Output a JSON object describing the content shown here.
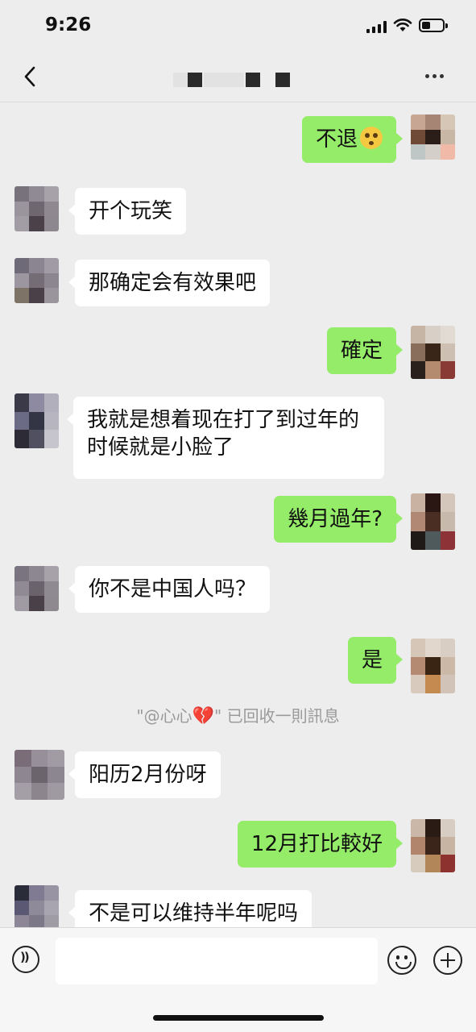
{
  "status": {
    "time": "9:26"
  },
  "header": {
    "back_icon": "chevron-left-icon",
    "more_icon": "more-dots-icon"
  },
  "messages": [
    {
      "side": "out",
      "text": "不退"
    },
    {
      "side": "in",
      "text": "开个玩笑"
    },
    {
      "side": "in",
      "text": "那确定会有效果吧"
    },
    {
      "side": "out",
      "text": "確定"
    },
    {
      "side": "in",
      "text": "我就是想着现在打了到过年的时候就是小脸了"
    },
    {
      "side": "out",
      "text": "幾月過年?"
    },
    {
      "side": "in",
      "text": "你不是中国人吗？"
    },
    {
      "side": "out",
      "text": "是"
    },
    {
      "side": "system",
      "prefix": "\"@心心",
      "suffix": "\" 已回收一則訊息"
    },
    {
      "side": "in",
      "text": "阳历2月份呀"
    },
    {
      "side": "out",
      "text": "12月打比較好"
    },
    {
      "side": "in",
      "text": "不是可以维持半年呢吗"
    }
  ],
  "input": {
    "placeholder": ""
  },
  "colors": {
    "outgoing": "#95ec69",
    "incoming": "#ffffff",
    "background": "#ededed"
  }
}
